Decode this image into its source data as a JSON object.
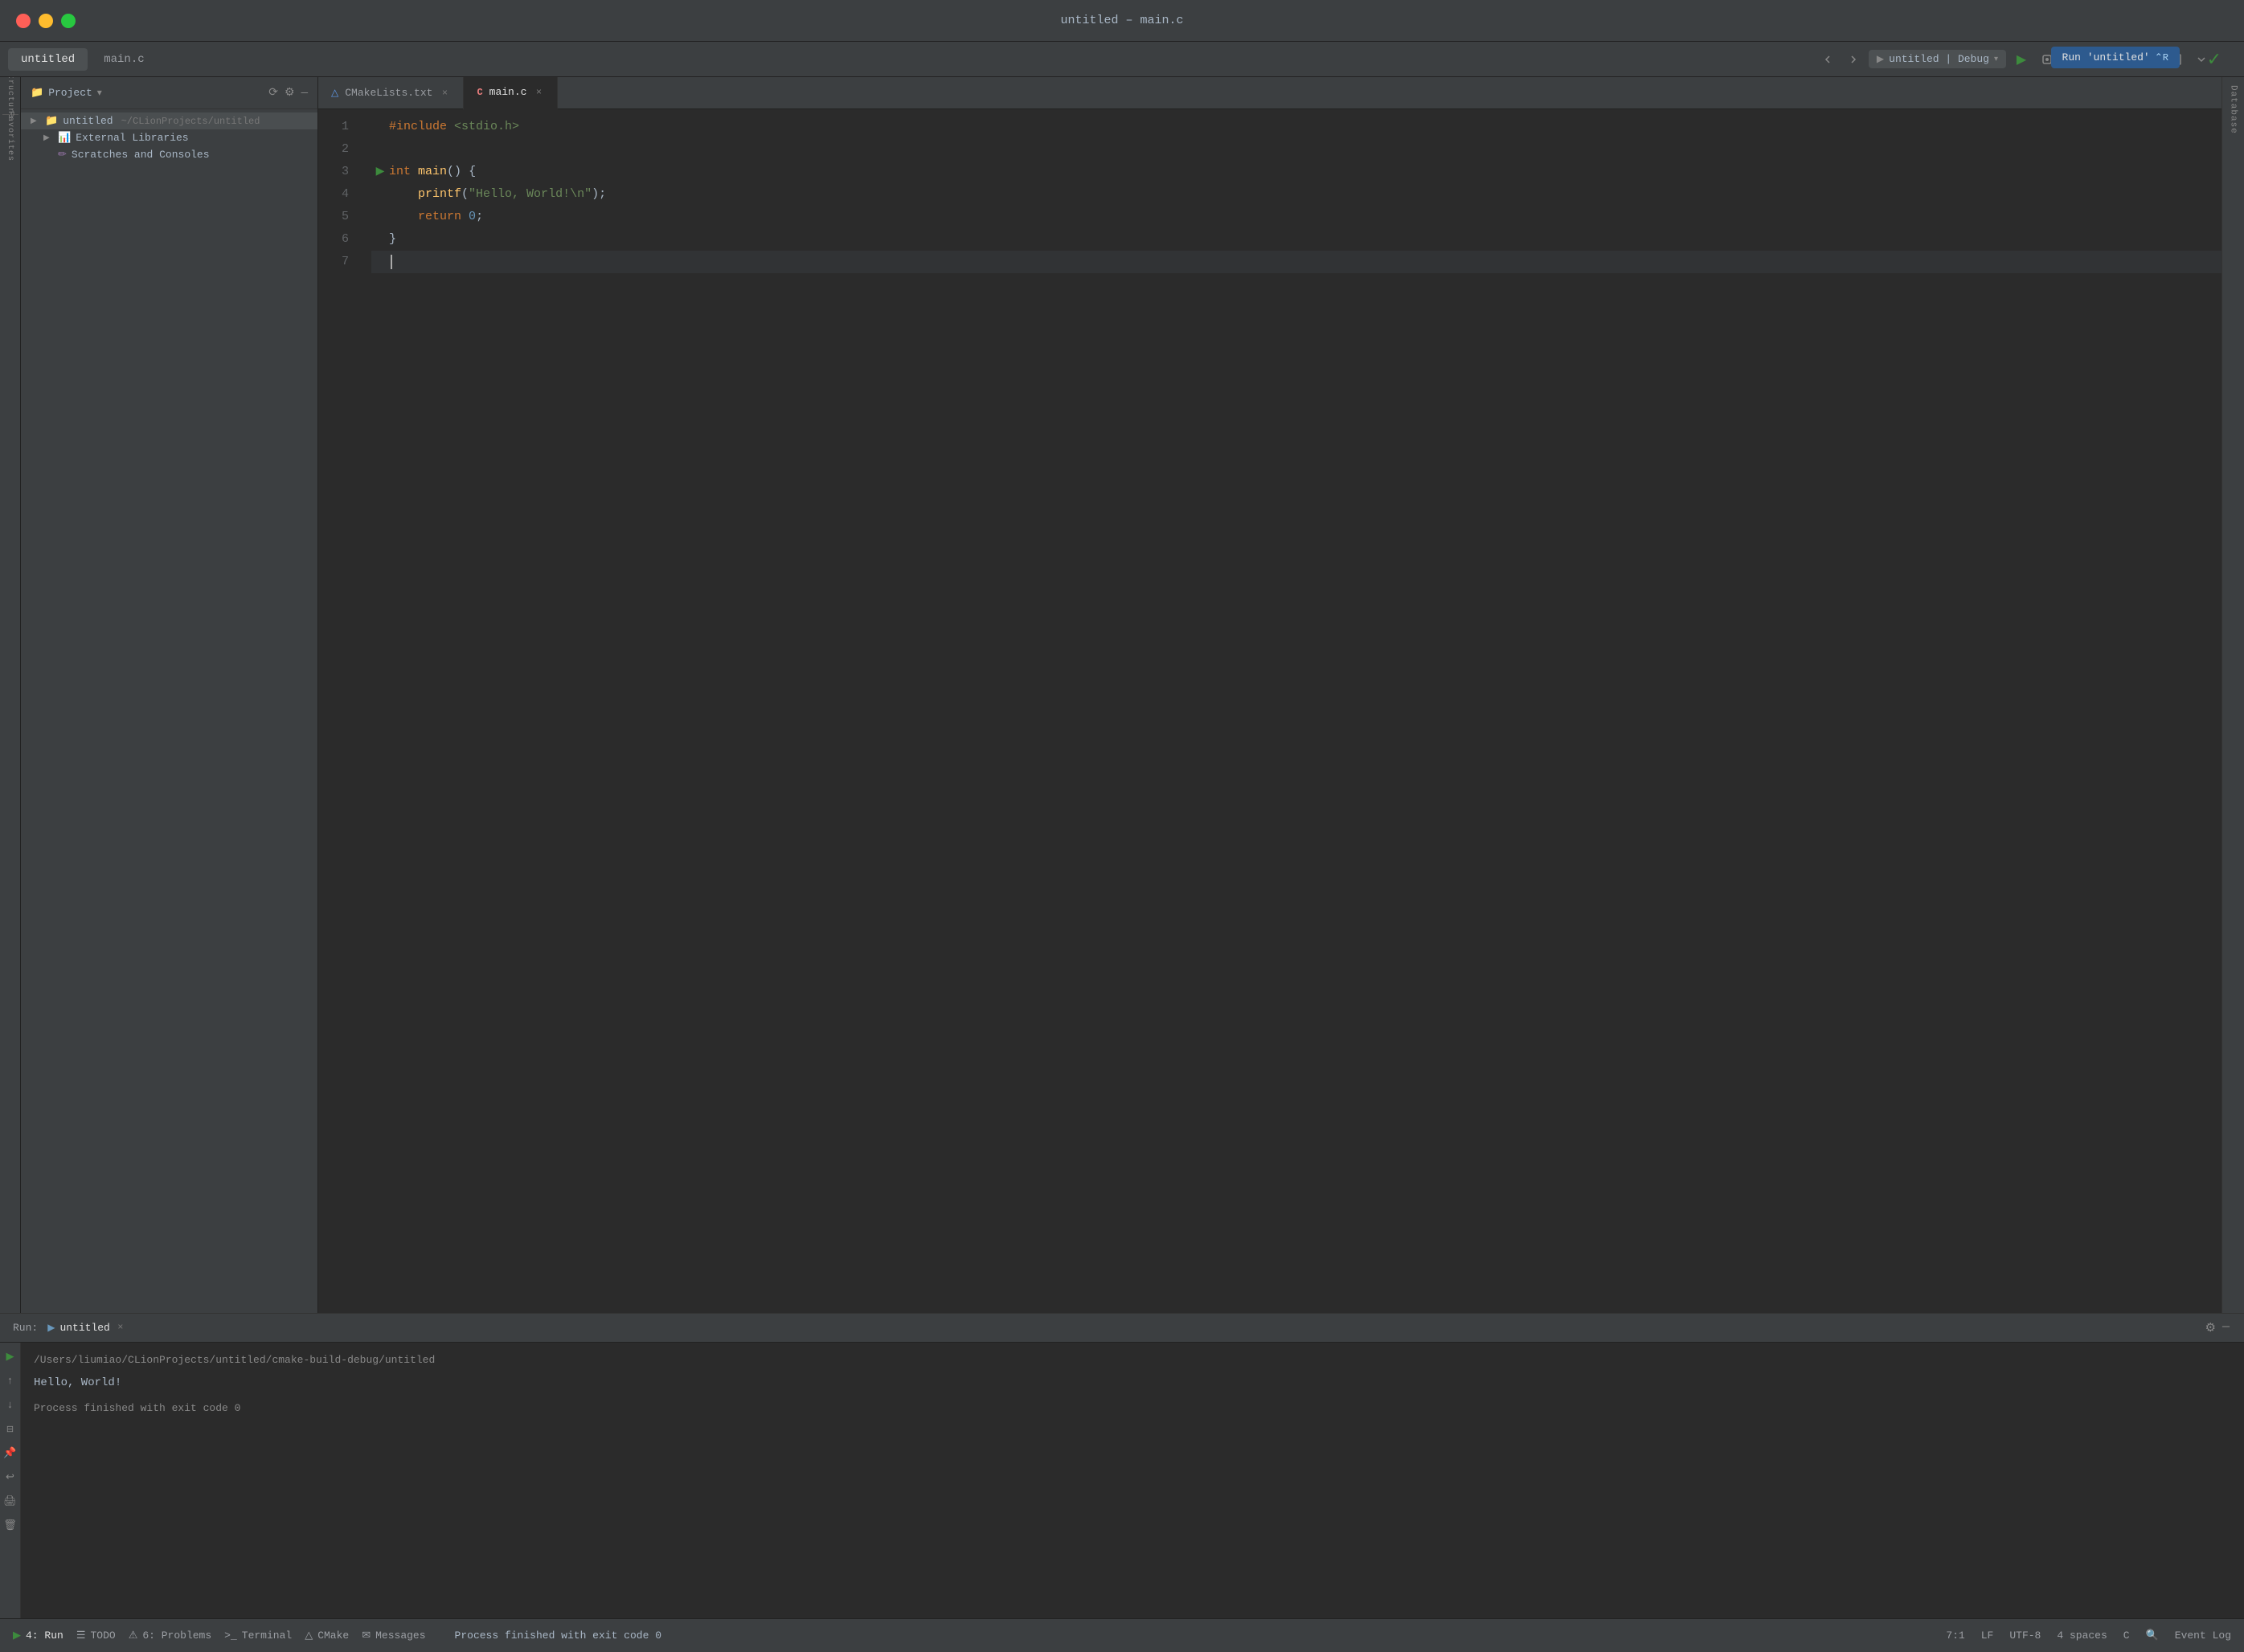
{
  "window": {
    "title": "untitled – main.c"
  },
  "dots": {
    "red": "#ff5f57",
    "yellow": "#febc2e",
    "green": "#28c840"
  },
  "app_tabs": [
    {
      "label": "untitled",
      "active": true
    },
    {
      "label": "main.c",
      "active": false
    }
  ],
  "toolbar": {
    "run_config": "untitled | Debug",
    "run_label": "Run 'untitled'",
    "run_shortcut": "⌃R"
  },
  "sidebar": {
    "title": "Project",
    "project_name": "untitled",
    "project_path": "~/CLionProjects/untitled",
    "items": [
      {
        "label": "untitled",
        "sublabel": "~/CLionProjects/untitled",
        "type": "project",
        "expanded": true
      },
      {
        "label": "External Libraries",
        "type": "library",
        "expanded": false
      },
      {
        "label": "Scratches and Consoles",
        "type": "scratches",
        "expanded": false
      }
    ]
  },
  "editor": {
    "tabs": [
      {
        "label": "CMakeLists.txt",
        "type": "cmake",
        "active": false
      },
      {
        "label": "main.c",
        "type": "c",
        "active": true
      }
    ],
    "lines": [
      {
        "num": 1,
        "content": "#include <stdio.h>",
        "type": "include"
      },
      {
        "num": 2,
        "content": "",
        "type": "blank"
      },
      {
        "num": 3,
        "content": "int main() {",
        "type": "main",
        "hasRunBtn": true
      },
      {
        "num": 4,
        "content": "    printf(\"Hello, World!\\n\");",
        "type": "printf"
      },
      {
        "num": 5,
        "content": "    return 0;",
        "type": "return"
      },
      {
        "num": 6,
        "content": "}",
        "type": "brace"
      },
      {
        "num": 7,
        "content": "",
        "type": "cursor"
      }
    ]
  },
  "run_panel": {
    "label": "Run:",
    "tab_name": "untitled",
    "path": "/Users/liumiao/CLionProjects/untitled/cmake-build-debug/untitled",
    "output": "Hello, World!",
    "process_msg": "Process finished with exit code 0"
  },
  "bottom_tabs": [
    {
      "label": "4: Run",
      "icon": "▶",
      "active": true
    },
    {
      "label": "TODO",
      "icon": "☰",
      "active": false
    },
    {
      "label": "6: Problems",
      "icon": "⚠",
      "active": false
    },
    {
      "label": "Terminal",
      "icon": ">_",
      "active": false
    },
    {
      "label": "CMake",
      "icon": "△",
      "active": false
    },
    {
      "label": "Messages",
      "icon": "✉",
      "active": false
    }
  ],
  "status_bar": {
    "message": "Process finished with exit code 0",
    "cursor_pos": "7:1",
    "line_ending": "LF",
    "encoding": "UTF-8",
    "indent": "4 spaces",
    "lang": "C",
    "search_icon": "🔍",
    "event_log": "Event Log"
  },
  "right_panel": {
    "label": "Database"
  }
}
